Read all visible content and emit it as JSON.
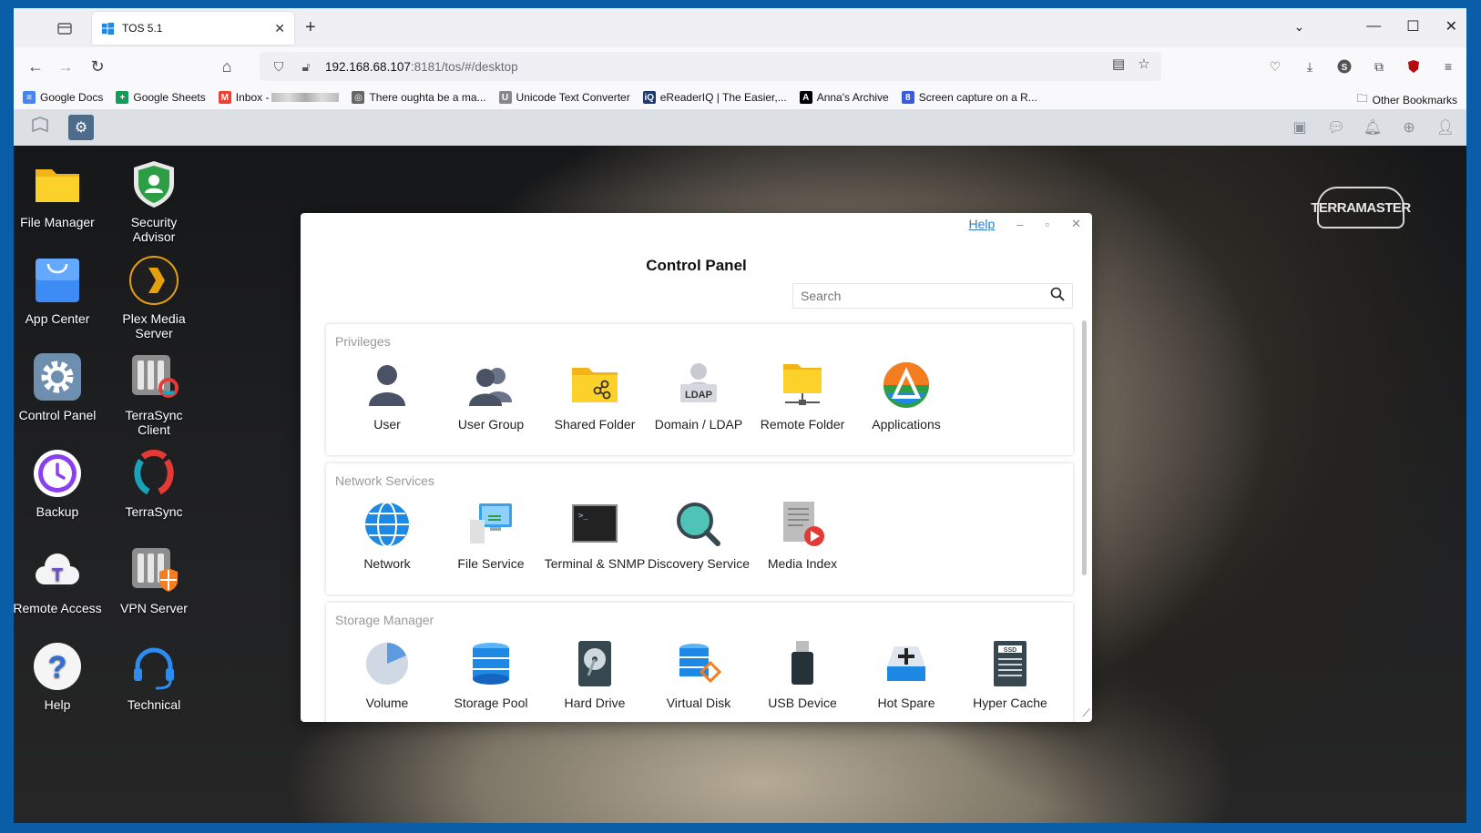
{
  "browser": {
    "tab": {
      "title": "TOS 5.1",
      "close": "✕"
    },
    "new_tab": "+",
    "url": {
      "host": "192.168.68.107",
      "rest": ":8181/tos/#/desktop"
    },
    "bookmarks": [
      {
        "label": "Google Docs",
        "color": "#4285f4",
        "glyph": "≡"
      },
      {
        "label": "Google Sheets",
        "color": "#0f9d58",
        "glyph": "+"
      },
      {
        "label": "Inbox -",
        "color": "#ea4335",
        "glyph": "M"
      },
      {
        "label": "There oughta be a ma...",
        "color": "#666666",
        "glyph": "◎"
      },
      {
        "label": "Unicode Text Converter",
        "color": "#888888",
        "glyph": "U"
      },
      {
        "label": "eReaderIQ | The Easier,...",
        "color": "#1c3a6e",
        "glyph": "iQ"
      },
      {
        "label": "Anna's Archive",
        "color": "#000000",
        "glyph": "A"
      },
      {
        "label": "Screen capture on a R...",
        "color": "#3b5bdb",
        "glyph": "8"
      }
    ],
    "other_bookmarks": "Other Bookmarks"
  },
  "desktop": {
    "brand": "TERRAMASTER",
    "icons": [
      {
        "label": "File Manager",
        "icon": "folder-icon"
      },
      {
        "label": "Security Advisor",
        "icon": "shield-icon"
      },
      {
        "label": "App Center",
        "icon": "shopping-bag-icon"
      },
      {
        "label": "Plex Media Server",
        "icon": "plex-icon"
      },
      {
        "label": "Control Panel",
        "icon": "gear-icon"
      },
      {
        "label": "TerraSync Client",
        "icon": "terrasync-client-icon"
      },
      {
        "label": "Backup",
        "icon": "clock-icon"
      },
      {
        "label": "TerraSync",
        "icon": "sync-icon"
      },
      {
        "label": "Remote Access",
        "icon": "cloud-icon"
      },
      {
        "label": "VPN Server",
        "icon": "vpn-icon"
      },
      {
        "label": "Help",
        "icon": "help-icon"
      },
      {
        "label": "Technical",
        "icon": "headset-icon"
      }
    ]
  },
  "control_panel": {
    "help": "Help",
    "title": "Control Panel",
    "search_placeholder": "Search",
    "sections": [
      {
        "title": "Privileges",
        "items": [
          {
            "label": "User",
            "icon": "user-icon"
          },
          {
            "label": "User Group",
            "icon": "user-group-icon"
          },
          {
            "label": "Shared Folder",
            "icon": "shared-folder-icon"
          },
          {
            "label": "Domain / LDAP",
            "icon": "ldap-icon"
          },
          {
            "label": "Remote Folder",
            "icon": "remote-folder-icon"
          },
          {
            "label": "Applications",
            "icon": "applications-icon"
          }
        ]
      },
      {
        "title": "Network Services",
        "items": [
          {
            "label": "Network",
            "icon": "globe-icon"
          },
          {
            "label": "File Service",
            "icon": "file-service-icon"
          },
          {
            "label": "Terminal & SNMP",
            "icon": "terminal-icon"
          },
          {
            "label": "Discovery Service",
            "icon": "magnifier-icon"
          },
          {
            "label": "Media Index",
            "icon": "media-index-icon"
          }
        ]
      },
      {
        "title": "Storage Manager",
        "items": [
          {
            "label": "Volume",
            "icon": "volume-icon"
          },
          {
            "label": "Storage Pool",
            "icon": "storage-pool-icon"
          },
          {
            "label": "Hard Drive",
            "icon": "hard-drive-icon"
          },
          {
            "label": "Virtual Disk",
            "icon": "virtual-disk-icon"
          },
          {
            "label": "USB Device",
            "icon": "usb-icon"
          },
          {
            "label": "Hot Spare",
            "icon": "hot-spare-icon"
          },
          {
            "label": "Hyper Cache",
            "icon": "ssd-icon"
          }
        ]
      }
    ]
  }
}
